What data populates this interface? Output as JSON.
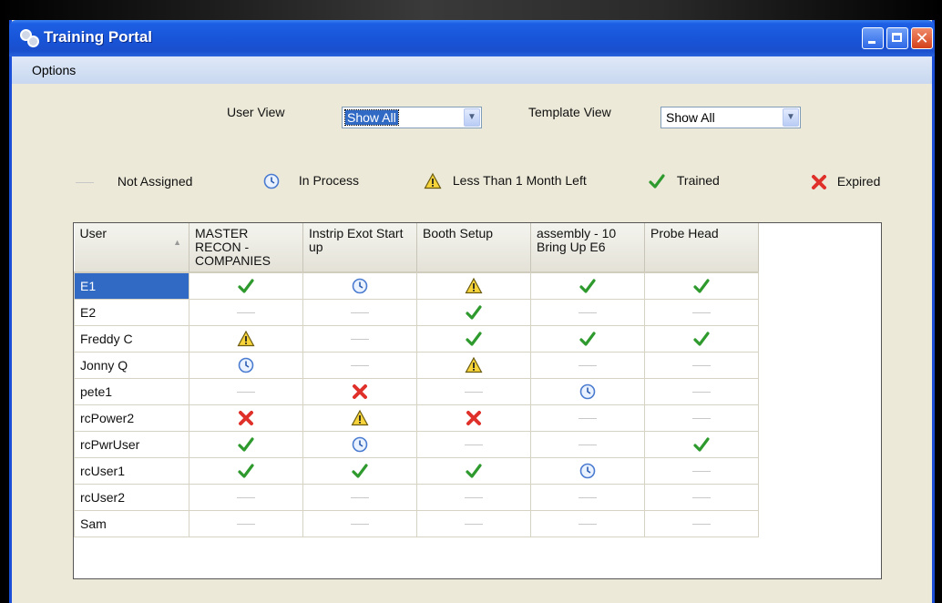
{
  "window": {
    "title": "Training Portal"
  },
  "menu": {
    "items": [
      "Options"
    ]
  },
  "filters": {
    "user_view_label": "User View",
    "user_view_value": "Show All",
    "template_view_label": "Template View",
    "template_view_value": "Show All"
  },
  "legend": {
    "not_assigned": "Not Assigned",
    "in_process": "In Process",
    "less_than_month": "Less Than 1 Month Left",
    "trained": "Trained",
    "expired": "Expired"
  },
  "grid": {
    "user_header": "User",
    "columns": [
      "MASTER RECON - COMPANIES",
      "Instrip Exot Start up",
      "Booth Setup",
      "assembly - 10 Bring Up E6",
      "Probe Head"
    ],
    "rows": [
      {
        "user": "E1",
        "status": [
          "trained",
          "in-process",
          "warning",
          "trained",
          "trained"
        ]
      },
      {
        "user": "E2",
        "status": [
          "none",
          "none",
          "trained",
          "none",
          "none"
        ]
      },
      {
        "user": "Freddy C",
        "status": [
          "warning",
          "none",
          "trained",
          "trained",
          "trained"
        ]
      },
      {
        "user": "Jonny Q",
        "status": [
          "in-process",
          "none",
          "warning",
          "none",
          "none"
        ]
      },
      {
        "user": "pete1",
        "status": [
          "none",
          "expired",
          "none",
          "in-process",
          "none"
        ]
      },
      {
        "user": "rcPower2",
        "status": [
          "expired",
          "warning",
          "expired",
          "none",
          "none"
        ]
      },
      {
        "user": "rcPwrUser",
        "status": [
          "trained",
          "in-process",
          "none",
          "none",
          "trained"
        ]
      },
      {
        "user": "rcUser1",
        "status": [
          "trained",
          "trained",
          "trained",
          "in-process",
          "none"
        ]
      },
      {
        "user": "rcUser2",
        "status": [
          "none",
          "none",
          "none",
          "none",
          "none"
        ]
      },
      {
        "user": "Sam",
        "status": [
          "none",
          "none",
          "none",
          "none",
          "none"
        ]
      }
    ]
  }
}
